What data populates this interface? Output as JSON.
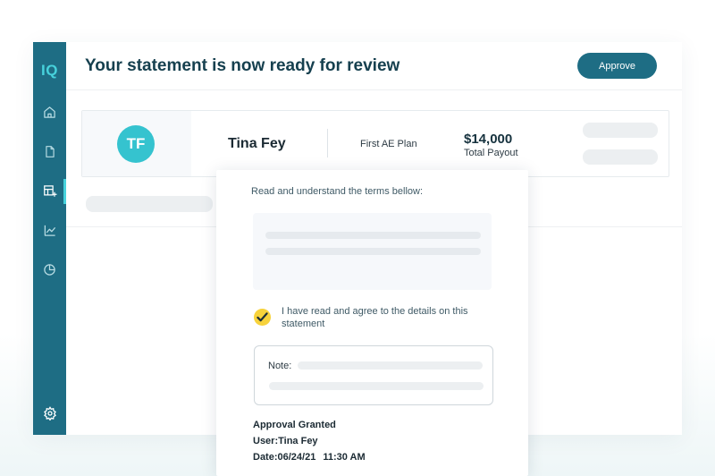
{
  "app": {
    "logo": "IQ",
    "sidebar": {
      "items": [
        {
          "icon": "home-icon"
        },
        {
          "icon": "document-icon"
        },
        {
          "icon": "table-add-icon",
          "active": true
        },
        {
          "icon": "line-chart-icon"
        },
        {
          "icon": "pie-chart-icon"
        }
      ],
      "bottom_icon": "gear-icon"
    },
    "header": {
      "title": "Your statement is now ready for review",
      "approve_label": "Approve"
    },
    "statement": {
      "initials": "TF",
      "rep_name": "Tina Fey",
      "plan": "First AE Plan",
      "payout_amount": "$14,000",
      "payout_label": "Total Payout"
    },
    "popup": {
      "terms_heading": "Read and understand the terms bellow:",
      "agree_text": "I have read and agree to the details on this statement",
      "agree_checked": true,
      "note_label": "Note:",
      "approval_status": "Approval Granted",
      "user_label": "User:",
      "user_value": "Tina Fey",
      "date_label": "Date:",
      "date_value": "06/24/21",
      "time_value": "11:30 AM"
    },
    "colors": {
      "sidebar": "#1e6d84",
      "accent": "#47d2dc",
      "avatar": "#35c3cf",
      "checkbox": "#f7d23b"
    }
  }
}
